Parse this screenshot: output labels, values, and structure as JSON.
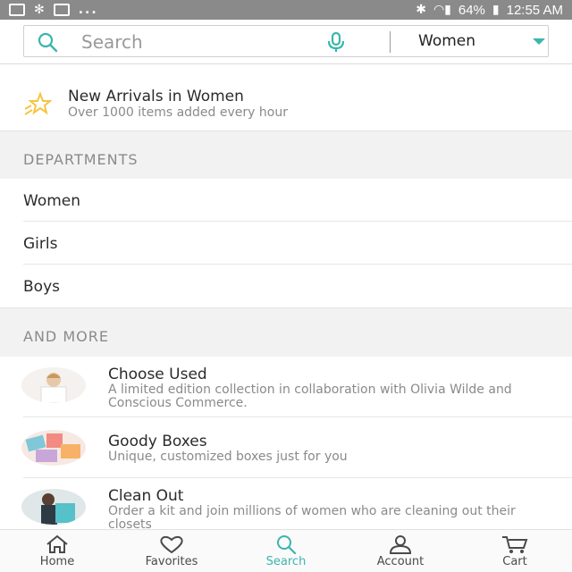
{
  "status_bar": {
    "left_icons": [
      "image-icon",
      "snowflake-icon",
      "mail-icon"
    ],
    "dots": "...",
    "battery": "64%",
    "time": "12:55 AM"
  },
  "search": {
    "placeholder": "Search",
    "department_selected": "Women"
  },
  "promo": {
    "title": "New Arrivals in Women",
    "subtitle": "Over 1000 items added every hour"
  },
  "departments": {
    "heading": "DEPARTMENTS",
    "items": [
      {
        "label": "Women"
      },
      {
        "label": "Girls"
      },
      {
        "label": "Boys"
      }
    ]
  },
  "and_more": {
    "heading": "AND MORE",
    "items": [
      {
        "title": "Choose Used",
        "description": "A limited edition collection in collaboration with Olivia Wilde and Conscious Commerce."
      },
      {
        "title": "Goody Boxes",
        "description": "Unique, customized boxes just for you"
      },
      {
        "title": "Clean Out",
        "description": "Order a kit and join millions of women who are cleaning out their closets"
      }
    ]
  },
  "bottom_nav": {
    "items": [
      {
        "label": "Home",
        "icon": "home-icon"
      },
      {
        "label": "Favorites",
        "icon": "heart-icon"
      },
      {
        "label": "Search",
        "icon": "search-icon",
        "active": true
      },
      {
        "label": "Account",
        "icon": "person-icon"
      },
      {
        "label": "Cart",
        "icon": "cart-icon"
      }
    ]
  },
  "colors": {
    "accent": "#3bb5ad",
    "status_bar": "#8a8a8a",
    "section_bg": "#f2f2f2",
    "star": "#f5c542"
  }
}
